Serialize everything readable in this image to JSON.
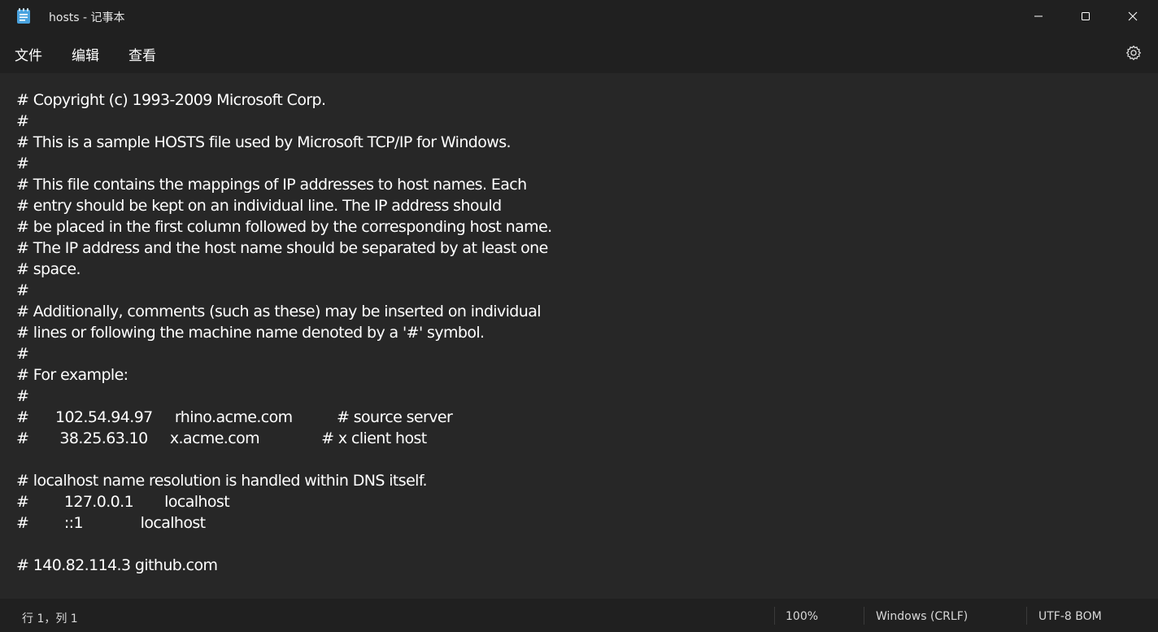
{
  "window": {
    "title": "hosts - 记事本"
  },
  "menu": {
    "items": [
      "文件",
      "编辑",
      "查看"
    ]
  },
  "editor": {
    "lines": [
      "# Copyright (c) 1993-2009 Microsoft Corp.",
      "#",
      "# This is a sample HOSTS file used by Microsoft TCP/IP for Windows.",
      "#",
      "# This file contains the mappings of IP addresses to host names. Each",
      "# entry should be kept on an individual line. The IP address should",
      "# be placed in the first column followed by the corresponding host name.",
      "# The IP address and the host name should be separated by at least one",
      "# space.",
      "#",
      "# Additionally, comments (such as these) may be inserted on individual",
      "# lines or following the machine name denoted by a '#' symbol.",
      "#",
      "# For example:",
      "#",
      "#      102.54.94.97     rhino.acme.com          # source server",
      "#       38.25.63.10     x.acme.com              # x client host",
      "",
      "# localhost name resolution is handled within DNS itself.",
      "#        127.0.0.1       localhost",
      "#        ::1             localhost",
      "",
      "# 140.82.114.3 github.com"
    ]
  },
  "status": {
    "position": "行 1，列 1",
    "zoom": "100%",
    "line_ending": "Windows (CRLF)",
    "encoding": "UTF-8 BOM"
  },
  "icons": {
    "app": "notepad-icon",
    "minimize": "minimize-icon",
    "maximize": "maximize-icon",
    "close": "close-icon",
    "settings": "gear-icon"
  },
  "colors": {
    "titlebar_bg": "#202020",
    "editor_bg": "#272727",
    "text": "#ffffff",
    "icon_accent": "#4aa3df"
  }
}
